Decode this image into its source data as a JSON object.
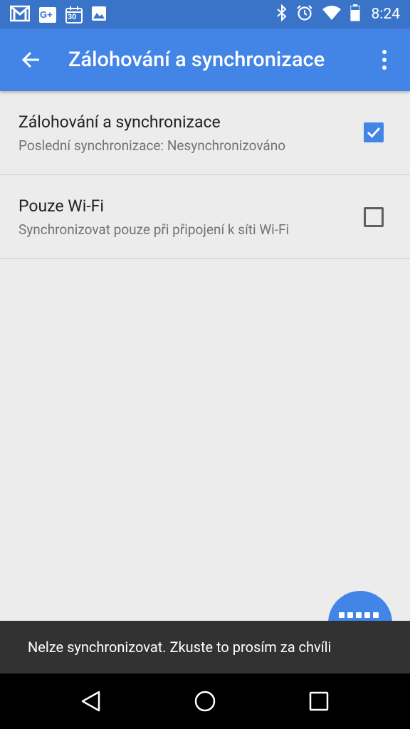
{
  "status_bar": {
    "time": "8:24",
    "notification_icons": [
      "gmail-icon",
      "google-plus-icon",
      "calendar-icon",
      "photos-icon"
    ],
    "system_icons": [
      "bluetooth-icon",
      "alarm-icon",
      "wifi-icon",
      "battery-icon"
    ],
    "calendar_day": "30",
    "gplus_label": "G+"
  },
  "app_bar": {
    "title": "Zálohování a synchronizace",
    "back_icon": "arrow-back-icon",
    "menu_icon": "more-vert-icon"
  },
  "settings": [
    {
      "title": "Zálohování a synchronizace",
      "summary": "Poslední synchronizace: Nesynchronizováno",
      "checked": true
    },
    {
      "title": "Pouze Wi-Fi",
      "summary": "Synchronizovat pouze při připojení k síti Wi-Fi",
      "checked": false
    }
  ],
  "snackbar": {
    "message": "Nelze synchronizovat. Zkuste to prosím za chvíli"
  },
  "fab": {
    "icon": "progress-dots-icon"
  },
  "nav_bar": {
    "back": "nav-back-icon",
    "home": "nav-home-icon",
    "recents": "nav-recents-icon"
  },
  "colors": {
    "status_bar": "#3a74c9",
    "app_bar": "#4285e6",
    "accent": "#4285e6",
    "background": "#ececec",
    "snackbar": "#323232"
  }
}
